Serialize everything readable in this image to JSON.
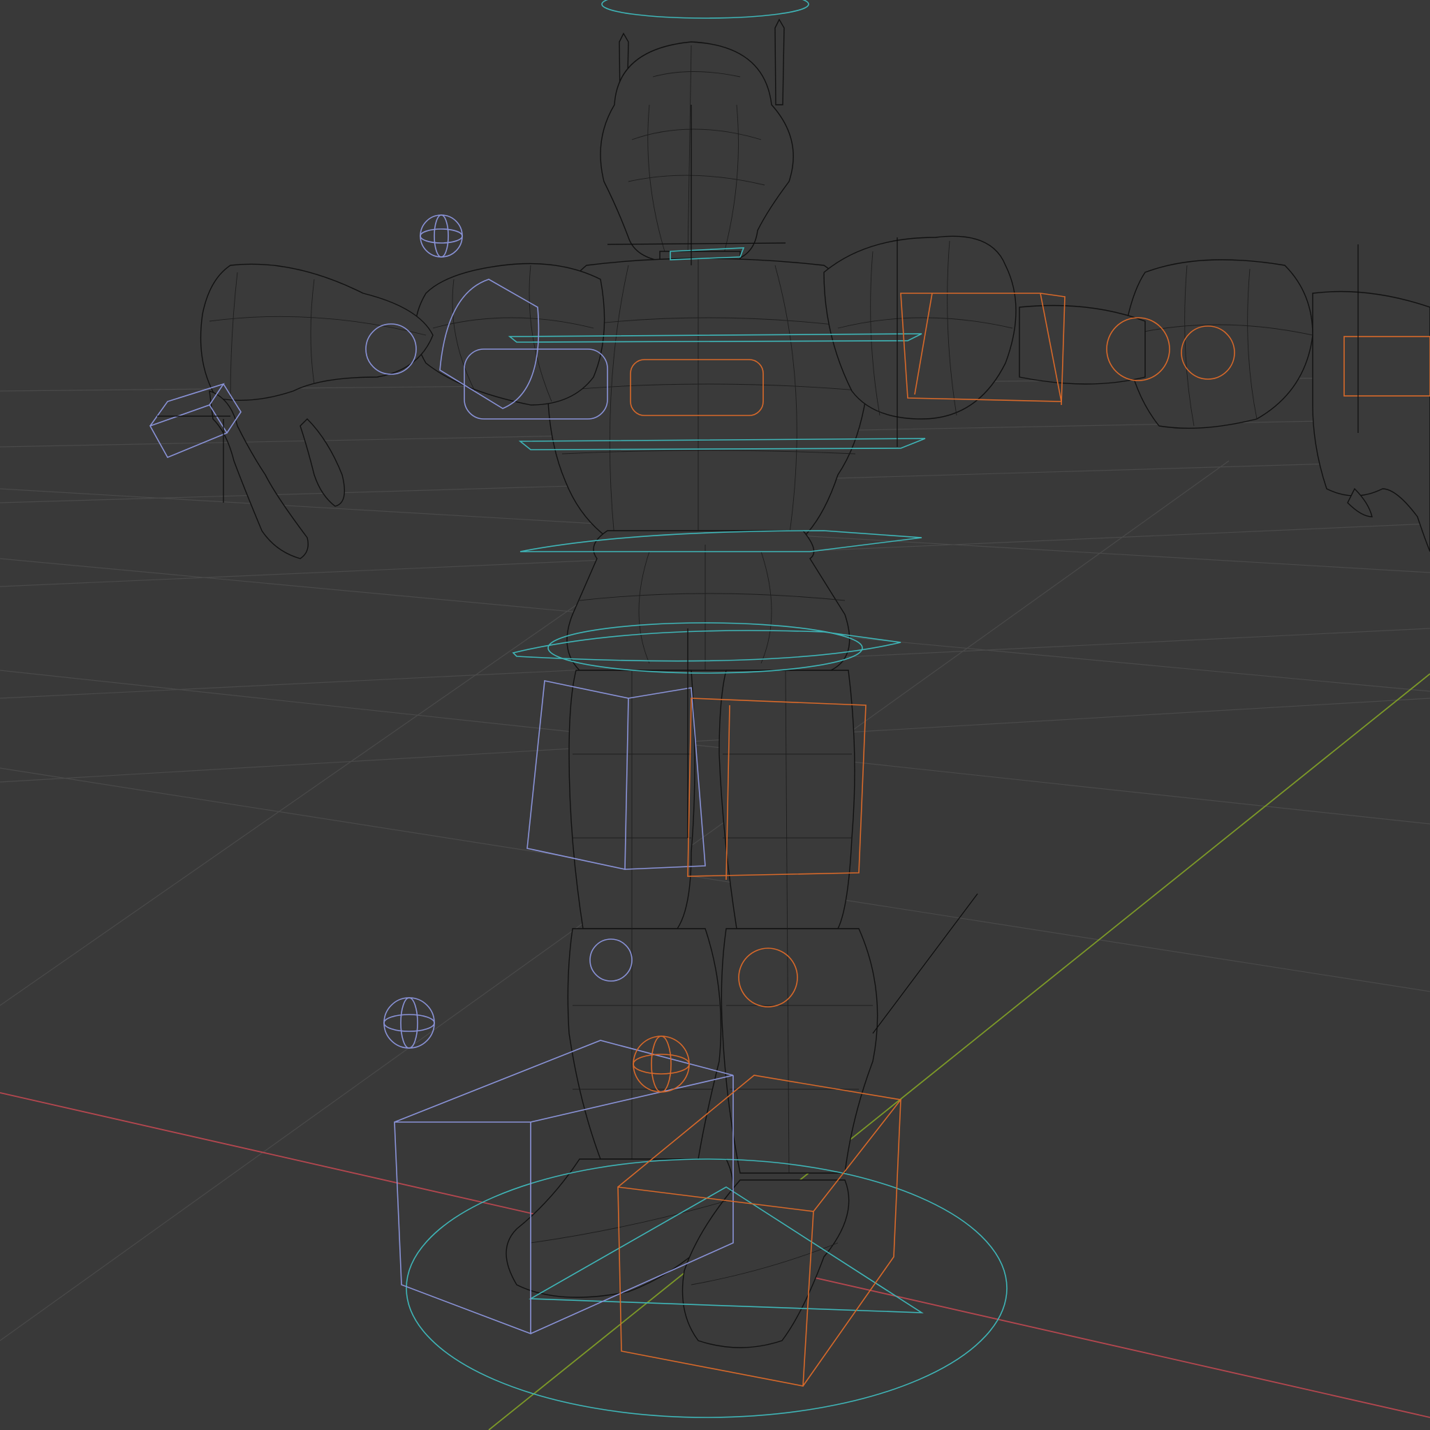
{
  "viewport": {
    "shading": "wireframe",
    "background": "#393939",
    "colors": {
      "grid": "#4a4a4a",
      "x_axis": "#b4474f",
      "y_axis": "#7d9a28",
      "mesh_wire": "#111111",
      "control_left": "#8a93d8",
      "control_right": "#d8692a",
      "control_center": "#3fb6b8"
    }
  },
  "scene": {
    "object": "robot-character",
    "rig": "armature-with-ik-controls",
    "icons": [
      "halo-ring-icon",
      "sphere-gizmo-icon",
      "cube-control-icon",
      "circle-control-icon",
      "root-ring-icon"
    ]
  }
}
